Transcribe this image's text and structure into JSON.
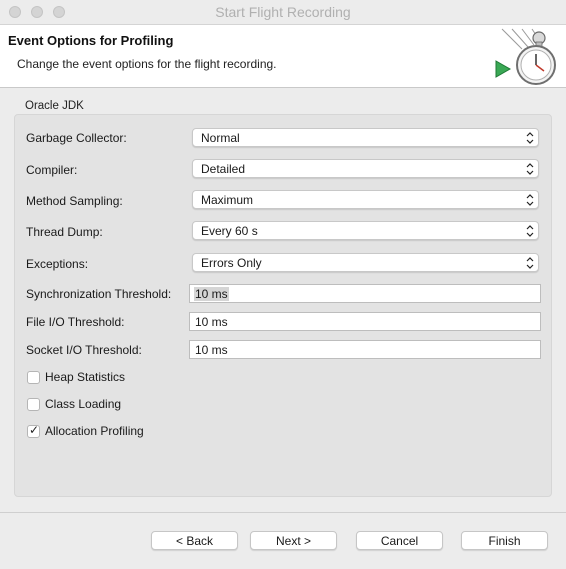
{
  "window": {
    "title": "Start Flight Recording"
  },
  "header": {
    "title": "Event Options for Profiling",
    "subtitle": "Change the event options for the flight recording."
  },
  "group": {
    "label": "Oracle JDK"
  },
  "selects": [
    {
      "label": "Garbage Collector:",
      "value": "Normal"
    },
    {
      "label": "Compiler:",
      "value": "Detailed"
    },
    {
      "label": "Method Sampling:",
      "value": "Maximum"
    },
    {
      "label": "Thread Dump:",
      "value": "Every 60 s"
    },
    {
      "label": "Exceptions:",
      "value": "Errors Only"
    }
  ],
  "fields": [
    {
      "label": "Synchronization Threshold:",
      "value": "10 ms"
    },
    {
      "label": "File I/O Threshold:",
      "value": "10 ms"
    },
    {
      "label": "Socket I/O Threshold:",
      "value": "10 ms"
    }
  ],
  "checkboxes": [
    {
      "label": "Heap Statistics",
      "checked": false
    },
    {
      "label": "Class Loading",
      "checked": false
    },
    {
      "label": "Allocation Profiling",
      "checked": true,
      "mark": "✓"
    }
  ],
  "buttons": {
    "back": "< Back",
    "next": "Next >",
    "cancel": "Cancel",
    "finish": "Finish"
  }
}
